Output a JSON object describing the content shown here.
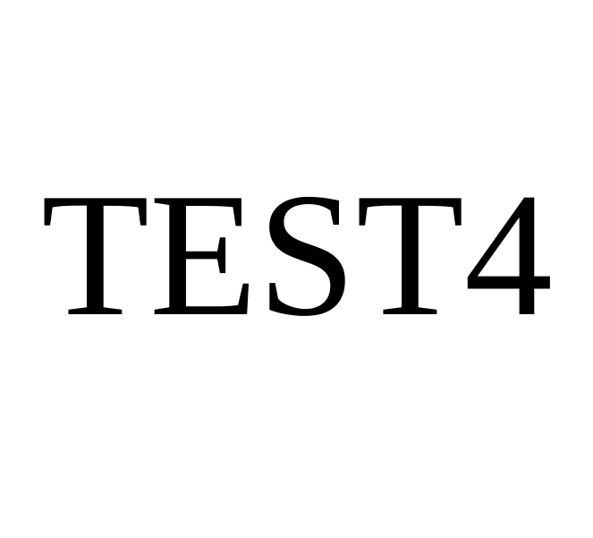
{
  "text": "TEST4",
  "colors": {
    "background": "#ffffff",
    "text": "#000000"
  }
}
